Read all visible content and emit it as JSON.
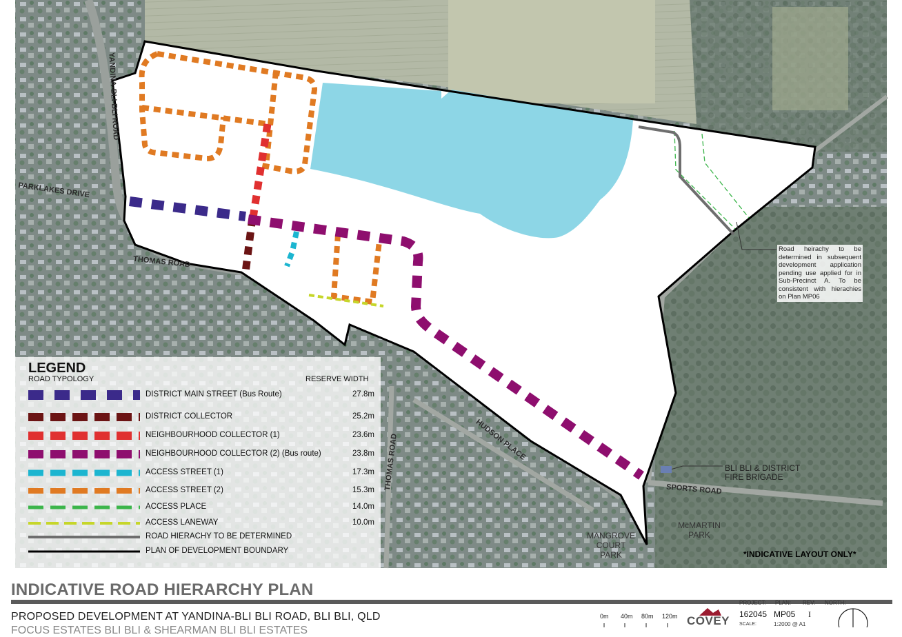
{
  "map": {
    "road_labels": {
      "yandina": "YANDINA-BLI-BLI ROAD",
      "parklakes": "PARKLAKES DRIVE",
      "thomas_road": "THOMAS ROAD",
      "thomas_road_2": "THOMAS ROAD",
      "hudson": "HUDSON PLACE",
      "sports": "SPORTS ROAD"
    },
    "places": {
      "fire_line1": "BLI BLI & DISTRICT",
      "fire_line2": "FIRE BRIGADE",
      "mangrove_line1": "MANGROVE",
      "mangrove_line2": "COURT",
      "mangrove_line3": "PARK",
      "mcmartin_line1": "McMARTIN",
      "mcmartin_line2": "PARK"
    },
    "note": "Road heirachy to be determined in subsequent development application pending use applied for in Sub-Precinct A. To be consistent with hierachies on Plan MP06",
    "indicative": "*INDICATIVE LAYOUT ONLY*"
  },
  "legend": {
    "title": "LEGEND",
    "subtitle": "ROAD TYPOLOGY",
    "reserve_header": "RESERVE WIDTH",
    "items": [
      {
        "label": "DISTRICT MAIN STREET (Bus Route)",
        "width": "27.8m",
        "color": "#3b2a8a"
      },
      {
        "label": "DISTRICT COLLECTOR",
        "width": "25.2m",
        "color": "#6b1414"
      },
      {
        "label": "NEIGHBOURHOOD COLLECTOR (1)",
        "width": "23.6m",
        "color": "#e03030"
      },
      {
        "label": "NEIGHBOURHOOD COLLECTOR (2) (Bus route)",
        "width": "23.8m",
        "color": "#8e0e6e"
      },
      {
        "label": "ACCESS STREET (1)",
        "width": "17.3m",
        "color": "#1cb5d0"
      },
      {
        "label": "ACCESS STREET (2)",
        "width": "15.3m",
        "color": "#e07a22"
      },
      {
        "label": "ACCESS PLACE",
        "width": "14.0m",
        "color": "#3bb54a"
      },
      {
        "label": "ACCESS LANEWAY",
        "width": "10.0m",
        "color": "#c6d62a"
      },
      {
        "label": "ROAD HIERACHY TO BE DETERMINED",
        "width": "",
        "color": "#6e6e6e"
      },
      {
        "label": "PLAN OF DEVELOPMENT BOUNDARY",
        "width": "",
        "color": "#000000"
      }
    ]
  },
  "titleblock": {
    "title": "INDICATIVE ROAD HIERARCHY PLAN",
    "subtitle": "PROPOSED DEVELOPMENT AT YANDINA-BLI BLI ROAD, BLI BLI, QLD",
    "subtitle2": "FOCUS ESTATES BLI BLI & SHEARMAN BLI BLI ESTATES",
    "project_label": "PROJECT:",
    "plan_label": "PLAN:",
    "rev_label": "REV:",
    "north_label": "NORTH:",
    "project": "162045",
    "plan": "MP05",
    "rev": "I",
    "scale_label": "SCALE:",
    "scale": "1:2000 @ A1",
    "logo": "COVEY",
    "scale_ticks": [
      "0m",
      "40m",
      "80m",
      "120m"
    ]
  },
  "colors": {
    "lake": "#8dd6e6",
    "aerial_base": "#8c9691",
    "farmland": "#b6bca6"
  }
}
